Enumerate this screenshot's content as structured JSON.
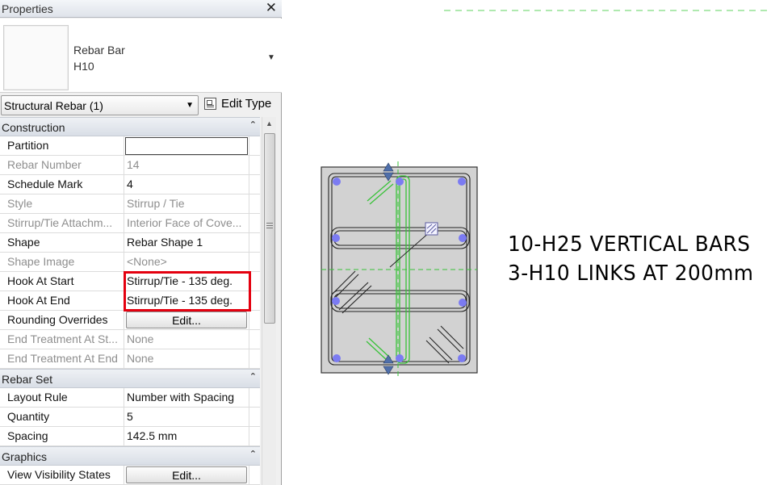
{
  "panel": {
    "title": "Properties",
    "type_selector": {
      "family": "Rebar Bar",
      "type": "H10"
    },
    "filter": {
      "value": "Structural Rebar (1)"
    },
    "edit_type_label": "Edit Type"
  },
  "groups": [
    {
      "label": "Construction",
      "rows": [
        {
          "name": "Partition",
          "value": "",
          "editable": true,
          "control": "input"
        },
        {
          "name": "Rebar Number",
          "value": "14",
          "editable": false
        },
        {
          "name": "Schedule Mark",
          "value": "4",
          "editable": true
        },
        {
          "name": "Style",
          "value": "Stirrup / Tie",
          "editable": false
        },
        {
          "name": "Stirrup/Tie Attachm...",
          "value": "Interior Face of Cove...",
          "editable": false
        },
        {
          "name": "Shape",
          "value": "Rebar Shape 1",
          "editable": true
        },
        {
          "name": "Shape Image",
          "value": "<None>",
          "editable": false
        },
        {
          "name": "Hook At Start",
          "value": "Stirrup/Tie - 135 deg.",
          "editable": true
        },
        {
          "name": "Hook At End",
          "value": "Stirrup/Tie - 135 deg.",
          "editable": true
        },
        {
          "name": "Rounding Overrides",
          "value": "Edit...",
          "editable": true,
          "control": "button"
        },
        {
          "name": "End Treatment At St...",
          "value": "None",
          "editable": false
        },
        {
          "name": "End Treatment At End",
          "value": "None",
          "editable": false
        }
      ]
    },
    {
      "label": "Rebar Set",
      "rows": [
        {
          "name": "Layout Rule",
          "value": "Number with Spacing",
          "editable": true
        },
        {
          "name": "Quantity",
          "value": "5",
          "editable": true
        },
        {
          "name": "Spacing",
          "value": "142.5 mm",
          "editable": true
        }
      ]
    },
    {
      "label": "Graphics",
      "rows": [
        {
          "name": "View Visibility States",
          "value": "Edit...",
          "editable": true,
          "control": "button"
        }
      ]
    }
  ],
  "drawing": {
    "note_line_1": "10-H25 VERTICAL BARS",
    "note_line_2": "3-H10 LINKS AT 200mm",
    "colors": {
      "concrete_fill": "#d2d2d2",
      "bar_dot": "#7b7bf2",
      "selected_rebar": "#39c239",
      "grip_arrow": "#4f6faa",
      "highlight_box": "#e4000f"
    }
  }
}
